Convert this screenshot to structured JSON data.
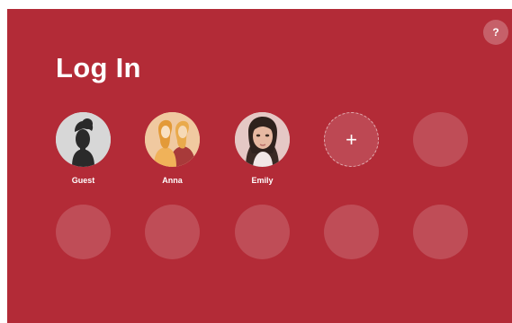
{
  "screen": {
    "title": "Log In",
    "help_icon": "?",
    "background_color": "#b32b37"
  },
  "users": [
    {
      "name": "Guest",
      "avatar": "guest-silhouette-icon"
    },
    {
      "name": "Anna",
      "avatar": "anna-illustration-icon"
    },
    {
      "name": "Emily",
      "avatar": "emily-photo"
    }
  ],
  "add_user": {
    "icon": "+",
    "icon_name": "plus-icon"
  },
  "empty_slot_count": 6
}
